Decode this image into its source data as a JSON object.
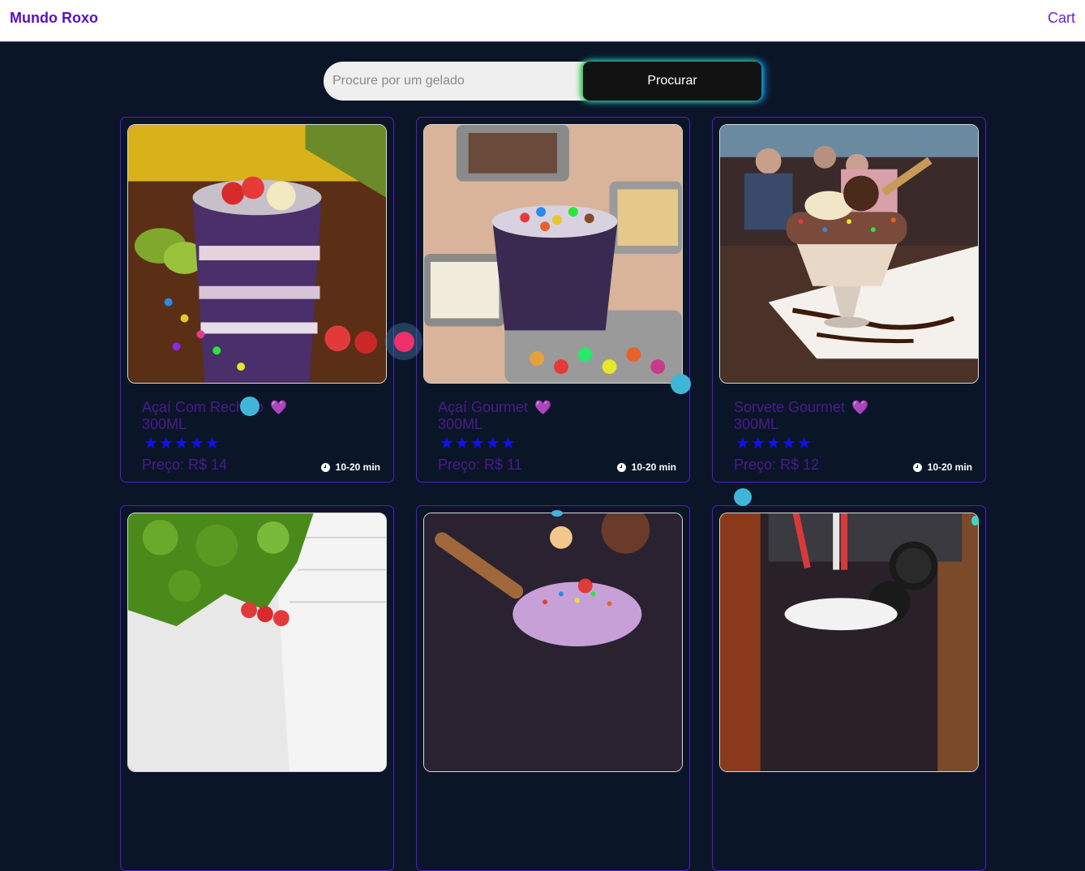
{
  "header": {
    "brand": "Mundo Roxo",
    "cart_label": "Cart"
  },
  "search": {
    "placeholder": "Procure por um gelado",
    "button_label": "Procurar"
  },
  "products": [
    {
      "name": "Açaí Com Recheio",
      "heart": "💜",
      "size": "300ML",
      "stars": "★★★★★",
      "price": "Preço: R$ 14",
      "eta": "10-20 min"
    },
    {
      "name": "Açaí Gourmet",
      "heart": "💜",
      "size": "300ML",
      "stars": "★★★★★",
      "price": "Preço: R$ 11",
      "eta": "10-20 min"
    },
    {
      "name": "Sorvete Gourmet",
      "heart": "💜",
      "size": "300ML",
      "stars": "★★★★★",
      "price": "Preço: R$ 12",
      "eta": "10-20 min"
    },
    {
      "name": "",
      "heart": "",
      "size": "",
      "stars": "",
      "price": "",
      "eta": ""
    },
    {
      "name": "",
      "heart": "",
      "size": "",
      "stars": "",
      "price": "",
      "eta": ""
    },
    {
      "name": "",
      "heart": "",
      "size": "",
      "stars": "",
      "price": "",
      "eta": ""
    }
  ],
  "colors": {
    "brand": "#5b0fc4",
    "background": "#0b1528",
    "card_border": "#5a16d6",
    "stars": "#1111ee"
  }
}
